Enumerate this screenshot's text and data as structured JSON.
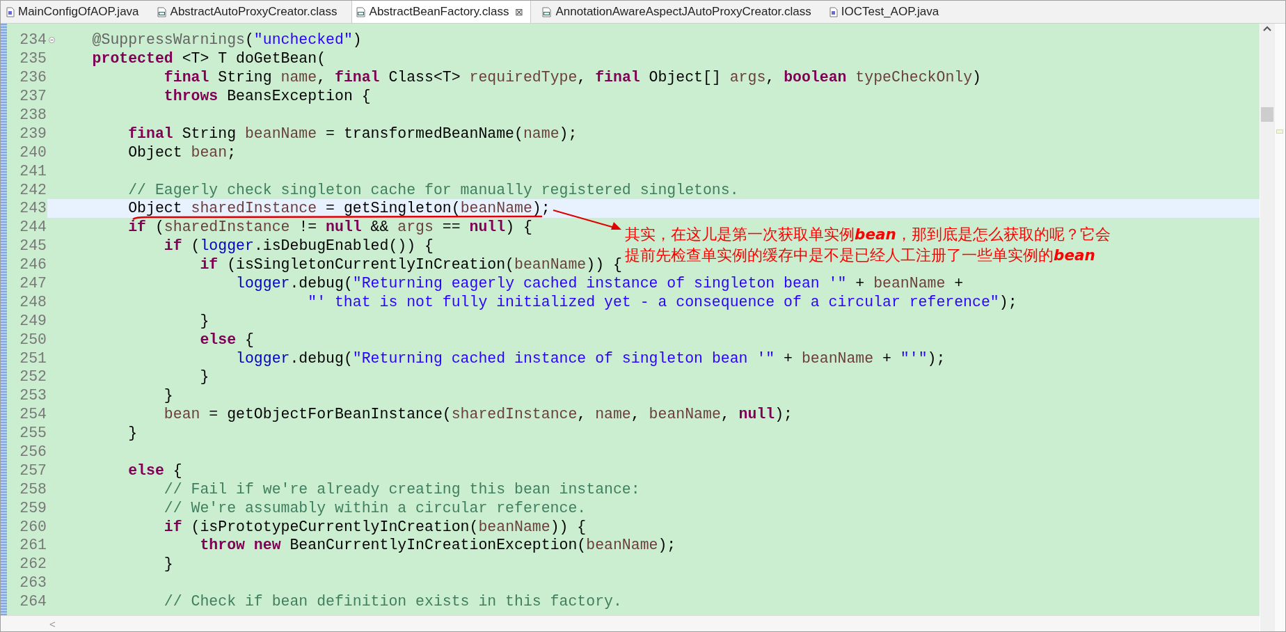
{
  "tabs": [
    {
      "label": "MainConfigOfAOP.java",
      "kind": "java",
      "selected": false
    },
    {
      "label": "AbstractAutoProxyCreator.class",
      "kind": "class",
      "selected": false
    },
    {
      "label": "AbstractBeanFactory.class",
      "kind": "class",
      "selected": true,
      "close": "⊠"
    },
    {
      "label": "AnnotationAwareAspectJAutoProxyCreator.class",
      "kind": "class",
      "selected": false
    },
    {
      "label": "IOCTest_AOP.java",
      "kind": "java",
      "selected": false
    }
  ],
  "editor": {
    "lines": [
      {
        "number": "234",
        "fold": true,
        "highlighted": false,
        "tokens": [
          {
            "text": "    @SuppressWarnings",
            "kind": "annotation"
          },
          {
            "text": "(",
            "kind": "plain"
          },
          {
            "text": "\"unchecked\"",
            "kind": "string"
          },
          {
            "text": ")",
            "kind": "plain"
          }
        ]
      },
      {
        "number": "235",
        "highlighted": false,
        "tokens": [
          {
            "text": "    protected",
            "kind": "keyword"
          },
          {
            "text": " <T> T doGetBean(",
            "kind": "plain"
          }
        ]
      },
      {
        "number": "236",
        "highlighted": false,
        "tokens": [
          {
            "text": "            final",
            "kind": "keyword"
          },
          {
            "text": " String ",
            "kind": "plain"
          },
          {
            "text": "name",
            "kind": "variable"
          },
          {
            "text": ", ",
            "kind": "plain"
          },
          {
            "text": "final",
            "kind": "keyword"
          },
          {
            "text": " Class<T> ",
            "kind": "plain"
          },
          {
            "text": "requiredType",
            "kind": "variable"
          },
          {
            "text": ", ",
            "kind": "plain"
          },
          {
            "text": "final",
            "kind": "keyword"
          },
          {
            "text": " Object[] ",
            "kind": "plain"
          },
          {
            "text": "args",
            "kind": "variable"
          },
          {
            "text": ", ",
            "kind": "plain"
          },
          {
            "text": "boolean",
            "kind": "keyword"
          },
          {
            "text": " typeCheckOnly",
            "kind": "variable"
          },
          {
            "text": ")",
            "kind": "plain"
          }
        ]
      },
      {
        "number": "237",
        "highlighted": false,
        "tokens": [
          {
            "text": "            throws",
            "kind": "keyword"
          },
          {
            "text": " BeansException {",
            "kind": "plain"
          }
        ]
      },
      {
        "number": "238",
        "highlighted": false
      },
      {
        "number": "239",
        "highlighted": false,
        "tokens": [
          {
            "text": "        final",
            "kind": "keyword"
          },
          {
            "text": " String ",
            "kind": "plain"
          },
          {
            "text": "beanName",
            "kind": "variable"
          },
          {
            "text": " = transformedBeanName(",
            "kind": "plain"
          },
          {
            "text": "name",
            "kind": "variable"
          },
          {
            "text": ");",
            "kind": "plain"
          }
        ]
      },
      {
        "number": "240",
        "highlighted": false,
        "tokens": [
          {
            "text": "        Object ",
            "kind": "plain"
          },
          {
            "text": "bean",
            "kind": "variable"
          },
          {
            "text": ";",
            "kind": "plain"
          }
        ]
      },
      {
        "number": "241",
        "highlighted": false
      },
      {
        "number": "242",
        "highlighted": false,
        "tokens": [
          {
            "text": "        // Eagerly check singleton cache for manually registered singletons.",
            "kind": "comment"
          }
        ]
      },
      {
        "number": "243",
        "highlighted": true,
        "tokens": [
          {
            "text": "        Object ",
            "kind": "plain"
          },
          {
            "text": "sharedInstance",
            "kind": "variable"
          },
          {
            "text": " = getSingleton(",
            "kind": "plain"
          },
          {
            "text": "beanName",
            "kind": "variable"
          },
          {
            "text": ");",
            "kind": "plain"
          }
        ]
      },
      {
        "number": "244",
        "highlighted": false,
        "tokens": [
          {
            "text": "        if",
            "kind": "keyword"
          },
          {
            "text": " (",
            "kind": "plain"
          },
          {
            "text": "sharedInstance",
            "kind": "variable"
          },
          {
            "text": " != ",
            "kind": "plain"
          },
          {
            "text": "null",
            "kind": "keyword"
          },
          {
            "text": " && ",
            "kind": "plain"
          },
          {
            "text": "args",
            "kind": "variable"
          },
          {
            "text": " == ",
            "kind": "plain"
          },
          {
            "text": "null",
            "kind": "keyword"
          },
          {
            "text": ") {",
            "kind": "plain"
          }
        ]
      },
      {
        "number": "245",
        "highlighted": false,
        "tokens": [
          {
            "text": "            if",
            "kind": "keyword"
          },
          {
            "text": " (",
            "kind": "plain"
          },
          {
            "text": "logger",
            "kind": "field"
          },
          {
            "text": ".isDebugEnabled()) {",
            "kind": "plain"
          }
        ]
      },
      {
        "number": "246",
        "highlighted": false,
        "tokens": [
          {
            "text": "                if",
            "kind": "keyword"
          },
          {
            "text": " (isSingletonCurrentlyInCreation(",
            "kind": "plain"
          },
          {
            "text": "beanName",
            "kind": "variable"
          },
          {
            "text": ")) {",
            "kind": "plain"
          }
        ]
      },
      {
        "number": "247",
        "highlighted": false,
        "tokens": [
          {
            "text": "                    logger",
            "kind": "field"
          },
          {
            "text": ".debug(",
            "kind": "plain"
          },
          {
            "text": "\"Returning eagerly cached instance of singleton bean '\"",
            "kind": "string"
          },
          {
            "text": " + ",
            "kind": "plain"
          },
          {
            "text": "beanName",
            "kind": "variable"
          },
          {
            "text": " +",
            "kind": "plain"
          }
        ]
      },
      {
        "number": "248",
        "highlighted": false,
        "tokens": [
          {
            "text": "                            \"' that is not fully initialized yet - a consequence of a circular reference\"",
            "kind": "string"
          },
          {
            "text": ");",
            "kind": "plain"
          }
        ]
      },
      {
        "number": "249",
        "highlighted": false,
        "tokens": [
          {
            "text": "                }",
            "kind": "plain"
          }
        ]
      },
      {
        "number": "250",
        "highlighted": false,
        "tokens": [
          {
            "text": "                else",
            "kind": "keyword"
          },
          {
            "text": " {",
            "kind": "plain"
          }
        ]
      },
      {
        "number": "251",
        "highlighted": false,
        "tokens": [
          {
            "text": "                    logger",
            "kind": "field"
          },
          {
            "text": ".debug(",
            "kind": "plain"
          },
          {
            "text": "\"Returning cached instance of singleton bean '\"",
            "kind": "string"
          },
          {
            "text": " + ",
            "kind": "plain"
          },
          {
            "text": "beanName",
            "kind": "variable"
          },
          {
            "text": " + ",
            "kind": "plain"
          },
          {
            "text": "\"'\"",
            "kind": "string"
          },
          {
            "text": ");",
            "kind": "plain"
          }
        ]
      },
      {
        "number": "252",
        "highlighted": false,
        "tokens": [
          {
            "text": "                }",
            "kind": "plain"
          }
        ]
      },
      {
        "number": "253",
        "highlighted": false,
        "tokens": [
          {
            "text": "            }",
            "kind": "plain"
          }
        ]
      },
      {
        "number": "254",
        "highlighted": false,
        "tokens": [
          {
            "text": "            bean",
            "kind": "variable"
          },
          {
            "text": " = getObjectForBeanInstance(",
            "kind": "plain"
          },
          {
            "text": "sharedInstance",
            "kind": "variable"
          },
          {
            "text": ", ",
            "kind": "plain"
          },
          {
            "text": "name",
            "kind": "variable"
          },
          {
            "text": ", ",
            "kind": "plain"
          },
          {
            "text": "beanName",
            "kind": "variable"
          },
          {
            "text": ", ",
            "kind": "plain"
          },
          {
            "text": "null",
            "kind": "keyword"
          },
          {
            "text": ");",
            "kind": "plain"
          }
        ]
      },
      {
        "number": "255",
        "highlighted": false,
        "tokens": [
          {
            "text": "        }",
            "kind": "plain"
          }
        ]
      },
      {
        "number": "256",
        "highlighted": false
      },
      {
        "number": "257",
        "highlighted": false,
        "tokens": [
          {
            "text": "        else",
            "kind": "keyword"
          },
          {
            "text": " {",
            "kind": "plain"
          }
        ]
      },
      {
        "number": "258",
        "highlighted": false,
        "tokens": [
          {
            "text": "            // Fail if we're already creating this bean instance:",
            "kind": "comment"
          }
        ]
      },
      {
        "number": "259",
        "highlighted": false,
        "tokens": [
          {
            "text": "            // We're assumably within a circular reference.",
            "kind": "comment"
          }
        ]
      },
      {
        "number": "260",
        "highlighted": false,
        "tokens": [
          {
            "text": "            if",
            "kind": "keyword"
          },
          {
            "text": " (isPrototypeCurrentlyInCreation(",
            "kind": "plain"
          },
          {
            "text": "beanName",
            "kind": "variable"
          },
          {
            "text": ")) {",
            "kind": "plain"
          }
        ]
      },
      {
        "number": "261",
        "highlighted": false,
        "tokens": [
          {
            "text": "                throw",
            "kind": "keyword"
          },
          {
            "text": " new",
            "kind": "keyword"
          },
          {
            "text": " BeanCurrentlyInCreationException(",
            "kind": "plain"
          },
          {
            "text": "beanName",
            "kind": "variable"
          },
          {
            "text": ");",
            "kind": "plain"
          }
        ]
      },
      {
        "number": "262",
        "highlighted": false,
        "tokens": [
          {
            "text": "            }",
            "kind": "plain"
          }
        ]
      },
      {
        "number": "263",
        "highlighted": false
      },
      {
        "number": "264",
        "highlighted": false,
        "tokens": [
          {
            "text": "            // Check if bean definition exists in this factory.",
            "kind": "comment"
          }
        ]
      }
    ],
    "note": {
      "lines": [
        "其实，在这儿是第一次获取单实例**bean**，那到底是怎么获取的呢？它会",
        "提前先检查单实例的缓存中是不是已经人工注册了一些单实例的**bean**"
      ]
    },
    "horizontal_scroll": {
      "left_arrow": "<"
    }
  }
}
